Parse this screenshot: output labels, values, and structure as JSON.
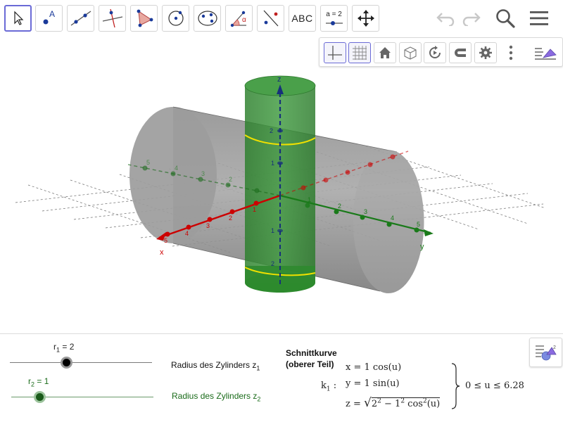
{
  "toolbar": {
    "tools": [
      {
        "name": "move",
        "label": ""
      },
      {
        "name": "point",
        "label": "A"
      },
      {
        "name": "line",
        "label": ""
      },
      {
        "name": "perpendicular-line",
        "label": ""
      },
      {
        "name": "polygon",
        "label": ""
      },
      {
        "name": "circle",
        "label": ""
      },
      {
        "name": "ellipse",
        "label": ""
      },
      {
        "name": "angle",
        "label": "α"
      },
      {
        "name": "reflect",
        "label": ""
      },
      {
        "name": "text",
        "label": "ABC"
      },
      {
        "name": "slider",
        "label": "a = 2"
      },
      {
        "name": "move-view",
        "label": ""
      }
    ],
    "icons": [
      "undo-icon",
      "redo-icon",
      "search-icon",
      "menu-icon"
    ]
  },
  "stylebar": {
    "buttons": [
      "axes-icon",
      "grid-icon",
      "home-icon",
      "view-cube-icon",
      "rotate-icon",
      "magnet-icon",
      "settings-icon",
      "more-icon",
      "view-toggle-icon"
    ]
  },
  "view3d": {
    "axis_labels": {
      "x": "x",
      "y": "y",
      "z": "z"
    },
    "x_ticks": [
      "1",
      "2",
      "3",
      "4",
      "5"
    ],
    "y_ticks": [
      "1",
      "2",
      "3",
      "4",
      "5"
    ],
    "y_neg_ticks": [
      "2",
      "3",
      "4",
      "5"
    ],
    "z_ticks": [
      "2",
      "1",
      "1",
      "2"
    ],
    "colors": {
      "x_axis": "#cc0000",
      "y_axis": "#1a7a1a",
      "z_axis": "#16307a",
      "horizontal_cylinder": "#8a8a8a",
      "vertical_cylinder": "#2f8a2f",
      "intersection_curve": "#f0e000"
    }
  },
  "sliders": [
    {
      "name": "r1",
      "var": "r",
      "sub": "1",
      "value": "2",
      "description": "Radius des Zylinders z",
      "desc_sub": "1",
      "color": "#000000",
      "fraction": 0.4
    },
    {
      "name": "r2",
      "var": "r",
      "sub": "2",
      "value": "1",
      "description": "Radius des Zylinders z",
      "desc_sub": "2",
      "color": "#1a6b1a",
      "fraction": 0.2
    }
  ],
  "curve": {
    "title_line1": "Schnittkurve",
    "title_line2": "(oberer Teil)",
    "name": "k",
    "name_sub": "1",
    "name_suffix": ":",
    "x_eq": "x = 1  cos(u)",
    "y_eq": "y = 1  sin(u)",
    "z_prefix": "z = ",
    "z_radicand_a": "2",
    "z_radicand_b": " − 1",
    "z_radicand_c": "  cos",
    "z_radicand_d": "(u)",
    "sup2": "2",
    "range": "0 ≤ u ≤ 6.28"
  }
}
